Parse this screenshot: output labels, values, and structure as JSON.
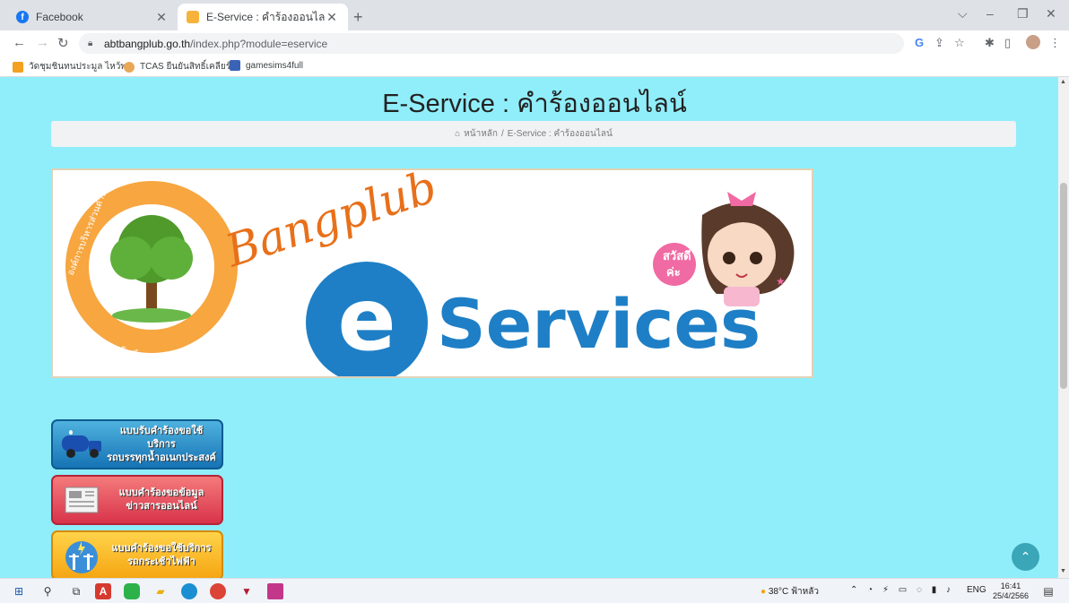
{
  "tabs": [
    {
      "title": "Facebook",
      "icon": "facebook-icon"
    },
    {
      "title": "E-Service : คำร้องออนไลน์",
      "icon": "eservice-favicon"
    }
  ],
  "address": {
    "host": "abtbangplub.go.th",
    "path": "/index.php?module=eservice"
  },
  "bookmarks": [
    {
      "label": "วัดชุมชินทนประมูล ไหว้พ...",
      "color": "#f4a020"
    },
    {
      "label": "TCAS ยืนยันสิทธิ์เคลียร์...",
      "color": "#e8a858"
    },
    {
      "label": "gamesims4full",
      "color": "#3a63b7"
    }
  ],
  "page": {
    "title": "E-Service : คำร้องออนไลน์",
    "breadcrumb_home": "หน้าหลัก",
    "breadcrumb_sep": "/",
    "breadcrumb_current": "E-Service : คำร้องออนไลน์"
  },
  "banner": {
    "script_text": "Bangplub",
    "logo_text": "e",
    "services_text": "Services",
    "seal_top": "องค์การบริหารส่วนตำบลบางพลับ",
    "seal_bottom": "อำเภอโพธิ์ทอง จังหวัดอ่างทอง",
    "greeting_1": "สวัสดี",
    "greeting_2": "ค่ะ"
  },
  "services": [
    {
      "line1": "แบบรับคำร้องขอใช้บริการ",
      "line2": "รถบรรทุกน้ำอเนกประสงค์",
      "icon": "water-truck-icon"
    },
    {
      "line1": "แบบคำร้องขอข้อมูล",
      "line2": "ข่าวสารออนไลน์",
      "icon": "newspaper-icon"
    },
    {
      "line1": "แบบคำร้องขอใช้บริการ",
      "line2": "รถกระเช้าไฟฟ้า",
      "icon": "electric-pole-icon"
    }
  ],
  "taskbar": {
    "weather": "38°C ฟ้าหลัว",
    "lang": "ENG",
    "time": "16:41",
    "date": "25/4/2566"
  },
  "colors": {
    "page_bg": "#90eefa",
    "accent_blue": "#1e7fc6",
    "script_orange": "#e8701a"
  }
}
